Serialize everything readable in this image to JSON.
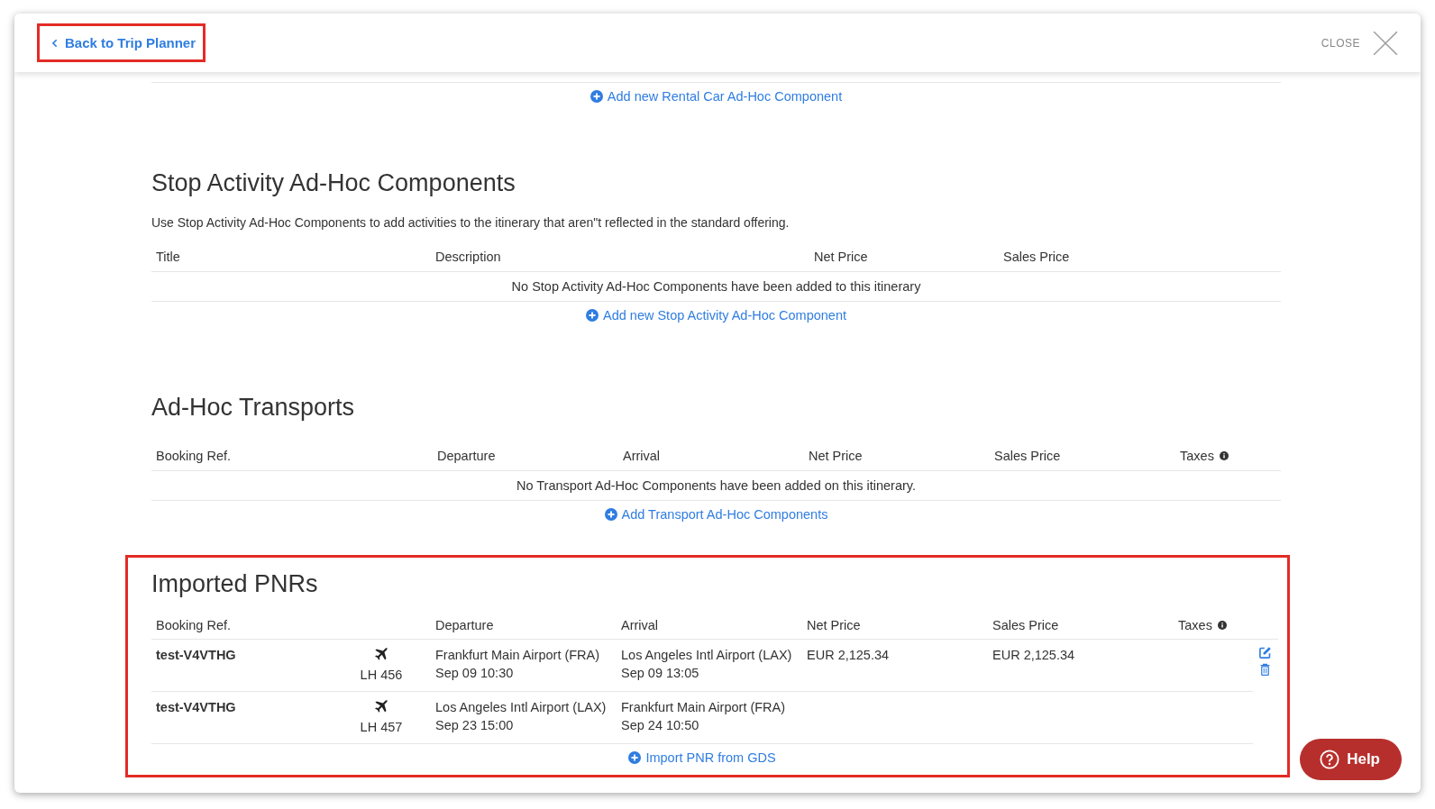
{
  "header": {
    "back_link": "Back to Trip Planner",
    "back_highlighted": true,
    "close_label": "CLOSE"
  },
  "rental_car": {
    "add_link": "Add new Rental Car Ad-Hoc Component"
  },
  "stop_activity": {
    "title": "Stop Activity Ad-Hoc Components",
    "description": "Use Stop Activity Ad-Hoc Components to add activities to the itinerary that aren\"t reflected in the standard offering.",
    "columns": [
      {
        "label": "Title",
        "info": false
      },
      {
        "label": "Description",
        "info": false
      },
      {
        "label": "Net Price",
        "info": false
      },
      {
        "label": "Sales Price",
        "info": false
      }
    ],
    "empty_message": "No Stop Activity Ad-Hoc Components have been added to this itinerary",
    "add_link": "Add new Stop Activity Ad-Hoc Component"
  },
  "transports": {
    "title": "Ad-Hoc Transports",
    "columns": [
      {
        "label": "Booking Ref.",
        "info": false
      },
      {
        "label": "Departure",
        "info": false
      },
      {
        "label": "Arrival",
        "info": false
      },
      {
        "label": "Net Price",
        "info": false
      },
      {
        "label": "Sales Price",
        "info": false
      },
      {
        "label": "Taxes",
        "info": true
      }
    ],
    "empty_message": "No Transport Ad-Hoc Components have been added on this itinerary.",
    "add_link": "Add Transport Ad-Hoc Components"
  },
  "imported_pnrs": {
    "title": "Imported PNRs",
    "highlighted": true,
    "columns": [
      {
        "label": "Booking Ref.",
        "info": false
      },
      {
        "label": "Departure",
        "info": false
      },
      {
        "label": "Arrival",
        "info": false
      },
      {
        "label": "Net Price",
        "info": false
      },
      {
        "label": "Sales Price",
        "info": false
      },
      {
        "label": "Taxes",
        "info": true
      }
    ],
    "rows": [
      {
        "booking_ref": "test-V4VTHG",
        "flight": "LH 456",
        "departure_airport": "Frankfurt Main Airport (FRA)",
        "departure_time": "Sep 09 10:30",
        "arrival_airport": "Los Angeles Intl Airport (LAX)",
        "arrival_time": "Sep 09 13:05",
        "net_price": "EUR 2,125.34",
        "sales_price": "EUR 2,125.34",
        "actions": true
      },
      {
        "booking_ref": "test-V4VTHG",
        "flight": "LH 457",
        "departure_airport": "Los Angeles Intl Airport (LAX)",
        "departure_time": "Sep 23 15:00",
        "arrival_airport": "Frankfurt Main Airport (FRA)",
        "arrival_time": "Sep 24 10:50",
        "actions": false
      }
    ],
    "import_link": "Import PNR from GDS"
  },
  "help_button": "Help"
}
